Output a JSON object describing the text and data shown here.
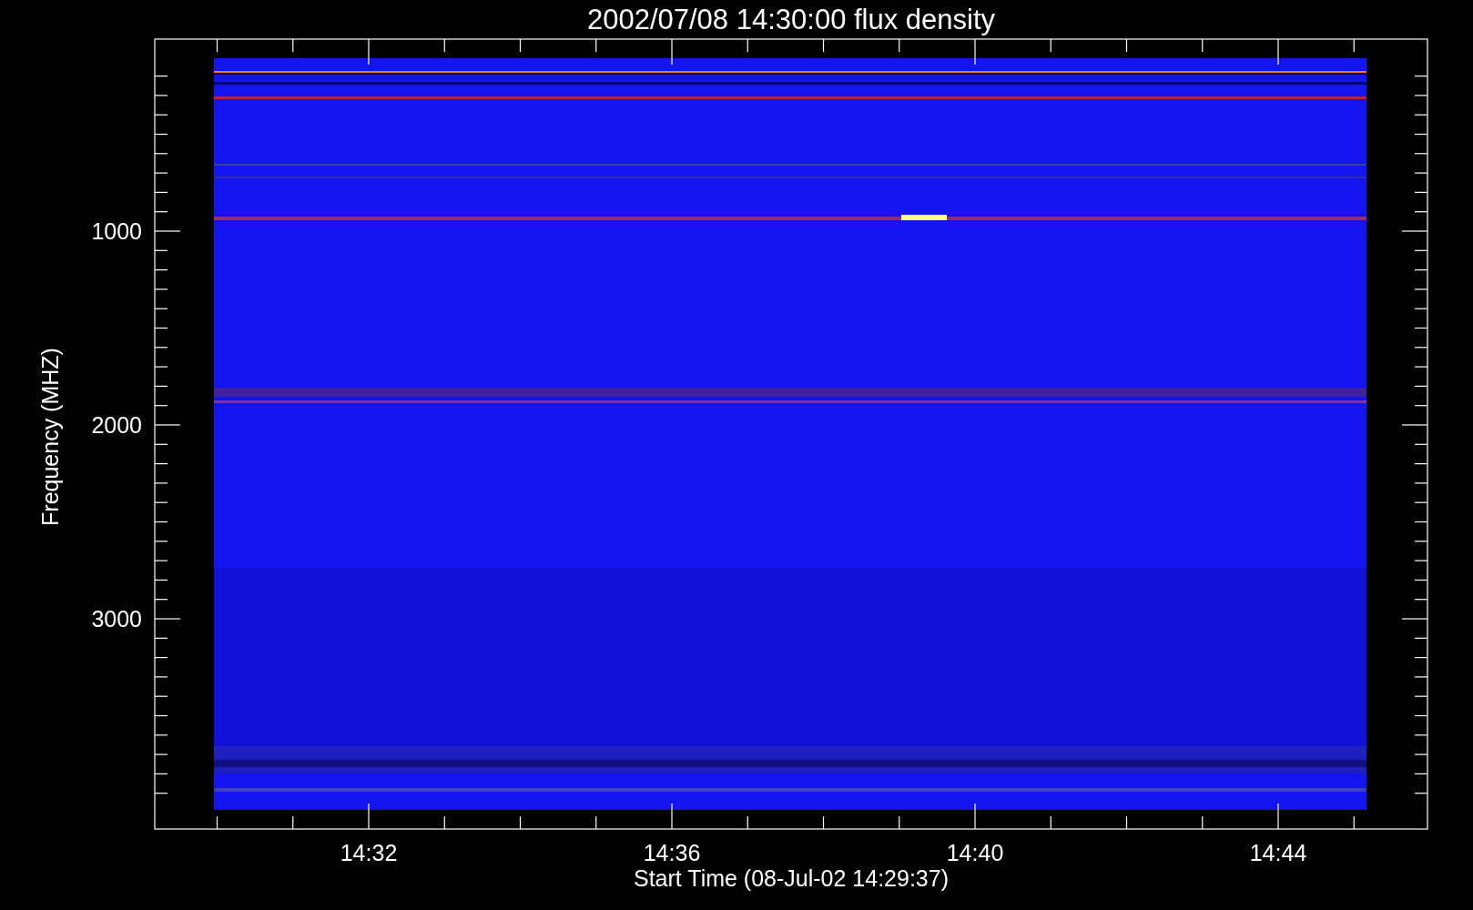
{
  "plot": {
    "title": "2002/07/08 14:30:00 flux density",
    "y_axis": {
      "title": "Frequency (MHZ)",
      "ticks": [
        "1000",
        "2000",
        "3000"
      ]
    },
    "x_axis": {
      "title": "Start Time (08-Jul-02 14:29:37)",
      "ticks": [
        "14:32",
        "14:36",
        "14:40",
        "14:44"
      ]
    }
  }
}
